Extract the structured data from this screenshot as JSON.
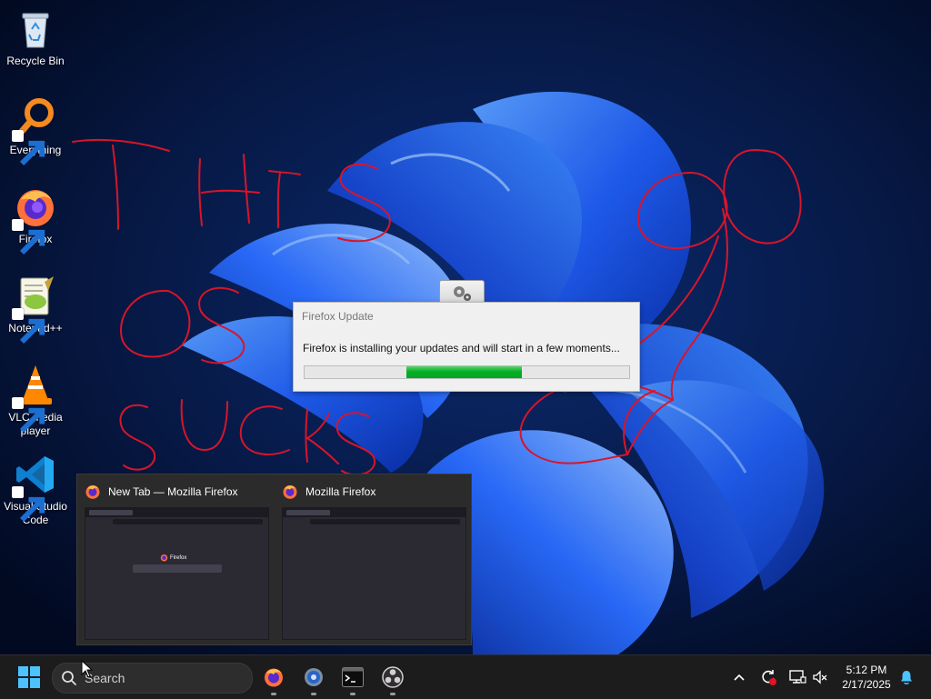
{
  "desktop": {
    "icons": [
      {
        "label": "Recycle Bin",
        "icon": "recycle-bin-icon"
      },
      {
        "label": "Everything",
        "icon": "everything-search-icon"
      },
      {
        "label": "Firefox",
        "icon": "firefox-icon"
      },
      {
        "label": "Notepad++",
        "icon": "notepad-plus-plus-icon"
      },
      {
        "label": "VLC media player",
        "icon": "vlc-icon"
      },
      {
        "label": "Visual Studio Code",
        "icon": "vscode-icon"
      }
    ],
    "annotation_color": "#d8152a"
  },
  "update_dialog": {
    "title": "Firefox Update",
    "message": "Firefox is installing your updates and will start in a few moments...",
    "progress": {
      "indeterminate": true,
      "segment_start": 0.315,
      "segment_end": 0.67,
      "color": "#06b025"
    }
  },
  "taskbar_preview": {
    "windows": [
      {
        "title": "New Tab — Mozilla Firefox",
        "page_logo_text": "Firefox"
      },
      {
        "title": "Mozilla Firefox"
      }
    ]
  },
  "taskbar": {
    "start_icon": "windows-start-icon",
    "search_placeholder": "Search",
    "pinned": [
      {
        "name": "Firefox",
        "icon": "firefox-icon",
        "running": true
      },
      {
        "name": "Settings",
        "icon": "settings-gear-icon",
        "running": true
      },
      {
        "name": "Terminal",
        "icon": "terminal-icon",
        "running": true
      },
      {
        "name": "OBS Studio",
        "icon": "obs-icon",
        "running": true
      }
    ],
    "tray": {
      "icons": [
        "chevron-up-icon",
        "sync-icon",
        "network-icon",
        "volume-muted-icon"
      ],
      "time": "5:12 PM",
      "date": "2/17/2025",
      "notification_icon": "bell-icon"
    }
  }
}
